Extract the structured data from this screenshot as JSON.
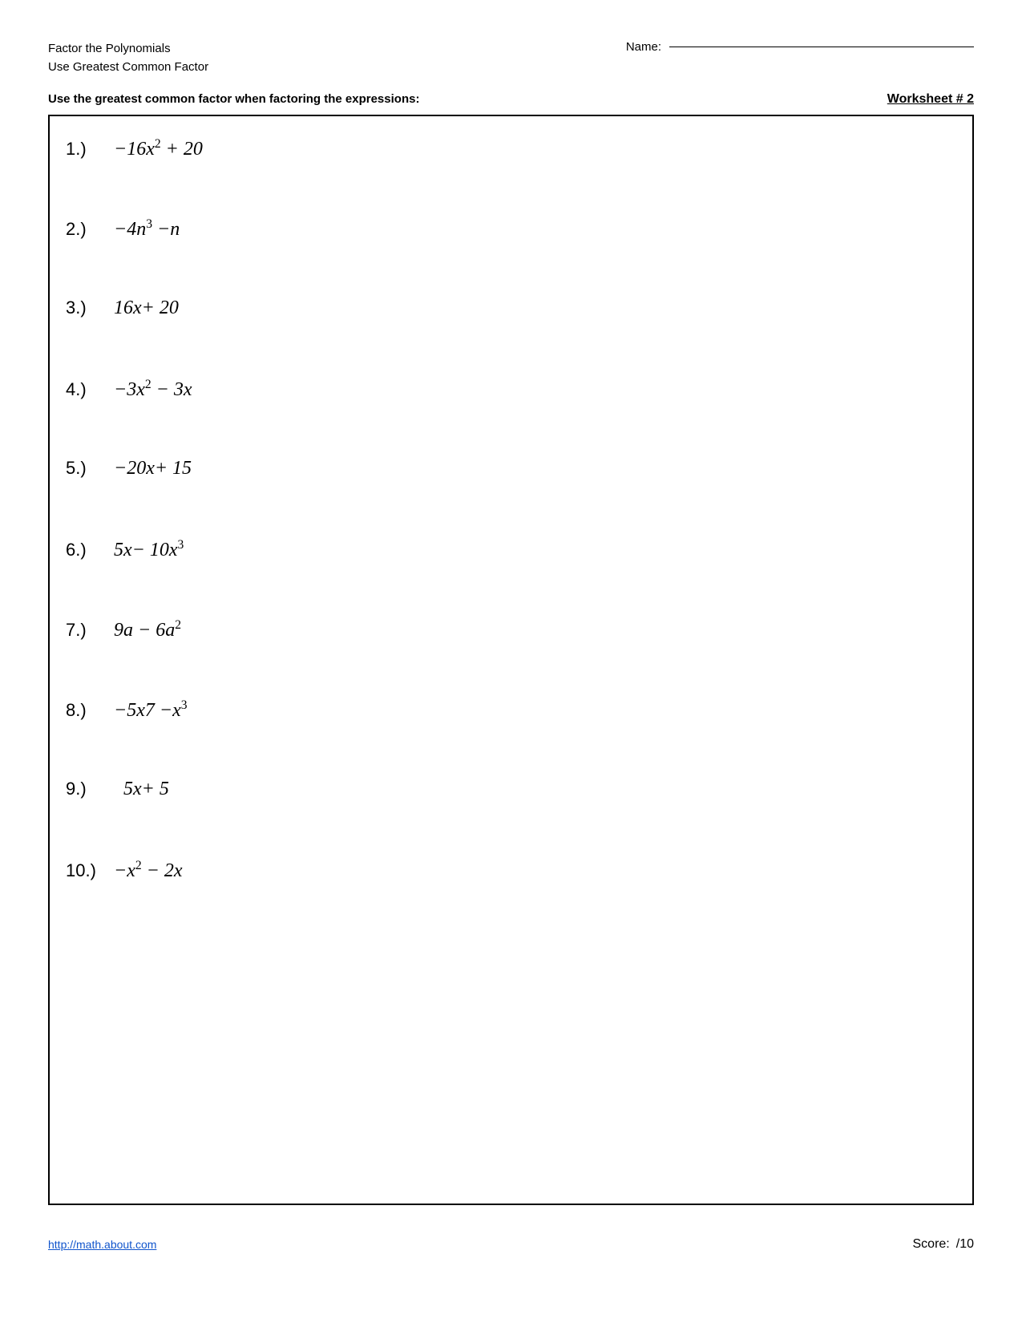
{
  "header": {
    "line1": "Factor the Polynomials",
    "line2": "Use Greatest Common Factor",
    "name_label": "Name:",
    "worksheet_title": "Worksheet # 2"
  },
  "instruction": {
    "text": "Use the greatest common factor when factoring the expressions:"
  },
  "problems": [
    {
      "number": "1.)",
      "html": "−16<i>x</i><sup>2</sup> + 20"
    },
    {
      "number": "2.)",
      "html": "−4<i>n</i><sup>3</sup> −<i>n</i>"
    },
    {
      "number": "3.)",
      "html": "16<i>x</i>+ 20"
    },
    {
      "number": "4.)",
      "html": "−3<i>x</i><sup>2</sup> − 3<i>x</i>"
    },
    {
      "number": "5.)",
      "html": "−20<i>x</i>+ 15"
    },
    {
      "number": "6.)",
      "html": "5<i>x</i>− 10<i>x</i><sup>3</sup>"
    },
    {
      "number": "7.)",
      "html": "9<i>a</i> − 6<i>a</i><sup>2</sup>"
    },
    {
      "number": "8.)",
      "html": "−5<i>x</i>7 −<i>x</i><sup>3</sup>"
    },
    {
      "number": "9.)",
      "html": "5<i>x</i>+ 5"
    },
    {
      "number": "10.)",
      "html": "−<i>x</i><sup>2</sup> − 2<i>x</i>"
    }
  ],
  "footer": {
    "link_text": "http://math.about.com",
    "score_label": "Score:",
    "score_value": "/10"
  }
}
